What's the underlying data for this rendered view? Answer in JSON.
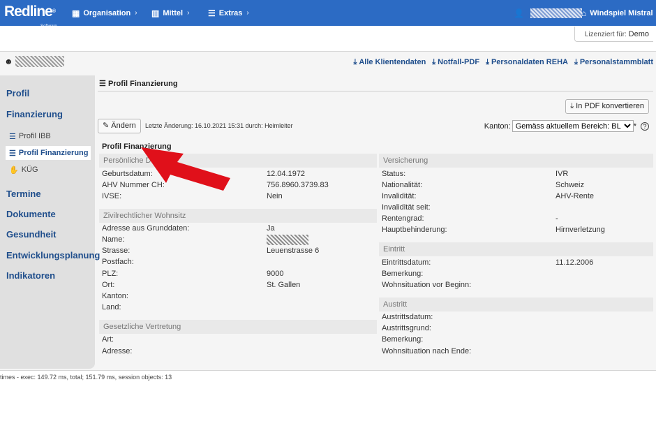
{
  "topbar": {
    "brand": "Redline",
    "brand_sub": "Software",
    "nav": [
      "Organisation",
      "Mittel",
      "Extras"
    ],
    "location": "Windspiel Mistral"
  },
  "license": {
    "label": "Lizenziert für:",
    "value": "Demo"
  },
  "actions": [
    "Alle Klientendaten",
    "Notfall-PDF",
    "Personaldaten REHA",
    "Personalstammblatt"
  ],
  "sidebar": {
    "items": [
      "Profil",
      "Finanzierung",
      "Termine",
      "Dokumente",
      "Gesundheit",
      "Entwicklungsplanung",
      "Indikatoren"
    ],
    "subitems": [
      "Profil IBB",
      "Profil Finanzierung",
      "KÜG"
    ]
  },
  "section": {
    "title": "Profil Finanzierung"
  },
  "toolbar": {
    "edit_label": "Ändern",
    "last_change": "Letzte Änderung: 16.10.2021 15:31 durch: Heimleiter",
    "pdf_label": "In PDF konvertieren",
    "kanton_label": "Kanton:",
    "kanton_value": "Gemäss aktuellem Bereich: BL",
    "kanton_star": "*"
  },
  "profile_title": "Profil Finanzierung",
  "left": {
    "personal": {
      "head": "Persönliche Da",
      "rows": [
        {
          "label": "Geburtsdatum:",
          "value": "12.04.1972"
        },
        {
          "label": "AHV Nummer CH:",
          "value": "756.8960.3739.83"
        },
        {
          "label": "IVSE:",
          "value": "Nein"
        }
      ]
    },
    "wohnsitz": {
      "head": "Zivilrechtlicher Wohnsitz",
      "rows": [
        {
          "label": "Adresse aus Grunddaten:",
          "value": "Ja"
        },
        {
          "label": "Name:",
          "value": ""
        },
        {
          "label": "Strasse:",
          "value": "Leuenstrasse 6"
        },
        {
          "label": "Postfach:",
          "value": ""
        },
        {
          "label": "PLZ:",
          "value": "9000"
        },
        {
          "label": "Ort:",
          "value": "St. Gallen"
        },
        {
          "label": "Kanton:",
          "value": ""
        },
        {
          "label": "Land:",
          "value": ""
        }
      ]
    },
    "vertretung": {
      "head": "Gesetzliche Vertretung",
      "rows": [
        {
          "label": "Art:",
          "value": ""
        },
        {
          "label": "Adresse:",
          "value": ""
        }
      ]
    }
  },
  "right": {
    "versicherung": {
      "head": "Versicherung",
      "rows": [
        {
          "label": "Status:",
          "value": "IVR"
        },
        {
          "label": "Nationalität:",
          "value": "Schweiz"
        },
        {
          "label": "Invalidität:",
          "value": "AHV-Rente"
        },
        {
          "label": "Invalidität seit:",
          "value": ""
        },
        {
          "label": "Rentengrad:",
          "value": "-"
        },
        {
          "label": "Hauptbehinderung:",
          "value": "Hirnverletzung"
        }
      ]
    },
    "eintritt": {
      "head": "Eintritt",
      "rows": [
        {
          "label": "Eintrittsdatum:",
          "value": "11.12.2006"
        },
        {
          "label": "Bemerkung:",
          "value": ""
        },
        {
          "label": "Wohnsituation vor Beginn:",
          "value": ""
        }
      ]
    },
    "austritt": {
      "head": "Austritt",
      "rows": [
        {
          "label": "Austrittsdatum:",
          "value": ""
        },
        {
          "label": "Austrittsgrund:",
          "value": ""
        },
        {
          "label": "Bemerkung:",
          "value": ""
        },
        {
          "label": "Wohnsituation nach Ende:",
          "value": ""
        }
      ]
    }
  },
  "footer": "times - exec: 149.72 ms, total; 151.79 ms, session objects: 13",
  "colors": {
    "header_blue": "#2c6bc4",
    "link_blue": "#1f4e8c",
    "annotation_red": "#e0101a"
  }
}
